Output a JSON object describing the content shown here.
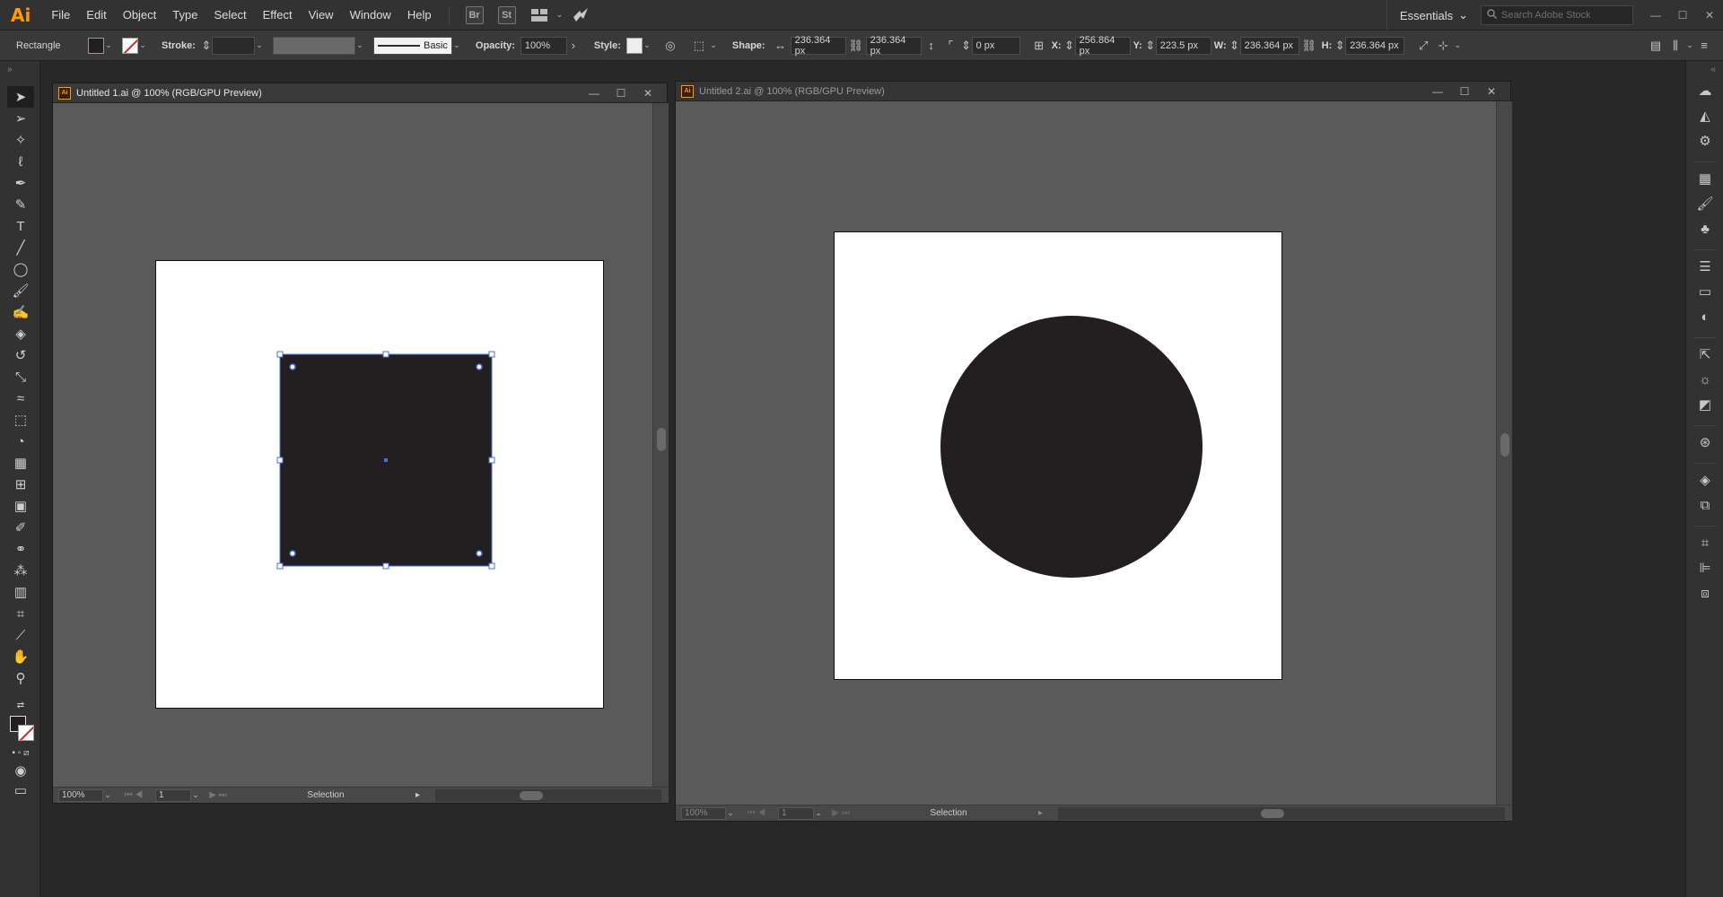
{
  "app": {
    "logo": "Ai"
  },
  "menu": [
    "File",
    "Edit",
    "Object",
    "Type",
    "Select",
    "Effect",
    "View",
    "Window",
    "Help"
  ],
  "menubar_icons": {
    "bridge": "Br",
    "stock": "St"
  },
  "workspace": {
    "label": "Essentials"
  },
  "search": {
    "placeholder": "Search Adobe Stock"
  },
  "control_bar": {
    "selection_type": "Rectangle",
    "stroke_label": "Stroke:",
    "brush_label": "Basic",
    "opacity_label": "Opacity:",
    "opacity_value": "100%",
    "style_label": "Style:",
    "shape_label": "Shape:",
    "shape_width": "236.364 px",
    "shape_height": "236.364 px",
    "corner_radius": "0 px",
    "x_label": "X:",
    "x_value": "256.864 px",
    "y_label": "Y:",
    "y_value": "223.5 px",
    "w_label": "W:",
    "w_value": "236.364 px",
    "h_label": "H:",
    "h_value": "236.364 px"
  },
  "documents": [
    {
      "title": "Untitled 1.ai @ 100% (RGB/GPU Preview)",
      "zoom": "100%",
      "page": "1",
      "status": "Selection",
      "active": true,
      "shape": "rectangle",
      "fill": "#231f20"
    },
    {
      "title": "Untitled 2.ai @ 100% (RGB/GPU Preview)",
      "zoom": "100%",
      "page": "1",
      "status": "Selection",
      "active": false,
      "shape": "circle",
      "fill": "#231f20"
    }
  ],
  "colors": {
    "brand": "#ff9a00",
    "selection": "#4a6fe0",
    "shape_fill": "#231f20"
  },
  "tools": [
    "selection-tool-icon",
    "direct-selection-tool-icon",
    "magic-wand-icon",
    "lasso-icon",
    "pen-tool-icon",
    "curvature-tool-icon",
    "type-tool-icon",
    "line-tool-icon",
    "ellipse-tool-icon",
    "paintbrush-icon",
    "shaper-tool-icon",
    "eraser-icon",
    "rotate-tool-icon",
    "scale-tool-icon",
    "warp-tool-icon",
    "free-transform-icon",
    "shape-builder-icon",
    "perspective-grid-icon",
    "mesh-tool-icon",
    "gradient-tool-icon",
    "eyedropper-icon",
    "blend-tool-icon",
    "symbol-sprayer-icon",
    "column-graph-icon",
    "artboard-tool-icon",
    "slice-tool-icon",
    "hand-tool-icon",
    "zoom-tool-icon"
  ],
  "panels": [
    "libraries-icon",
    "properties-icon",
    "cc-icon",
    "swatches-icon",
    "brushes-icon",
    "symbols-icon",
    "stroke-icon",
    "gradient-icon",
    "transparency-icon",
    "export-icon",
    "appearance-icon",
    "graphic-styles-icon",
    "cc-libraries-icon",
    "layers-icon",
    "artboards-icon",
    "transform-icon",
    "align-icon",
    "pathfinder-icon"
  ]
}
